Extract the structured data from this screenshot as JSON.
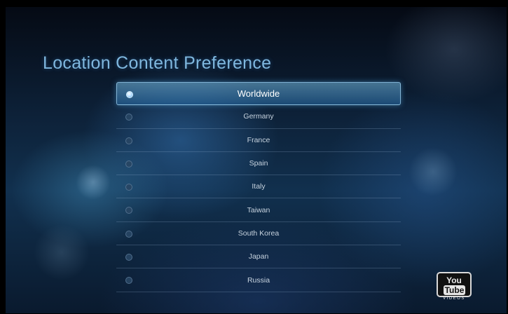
{
  "screen": {
    "title": "Location Content Preference"
  },
  "locations": [
    {
      "label": "Worldwide",
      "selected": true
    },
    {
      "label": "Germany",
      "selected": false
    },
    {
      "label": "France",
      "selected": false
    },
    {
      "label": "Spain",
      "selected": false
    },
    {
      "label": "Italy",
      "selected": false
    },
    {
      "label": "Taiwan",
      "selected": false
    },
    {
      "label": "South Korea",
      "selected": false
    },
    {
      "label": "Japan",
      "selected": false
    },
    {
      "label": "Russia",
      "selected": false
    }
  ],
  "brand": {
    "you": "You",
    "tube": "Tube",
    "sub": "VIDEOS"
  },
  "colors": {
    "title": "#7fb7de",
    "highlight": "#5aa8da",
    "background": "#0d2138"
  }
}
